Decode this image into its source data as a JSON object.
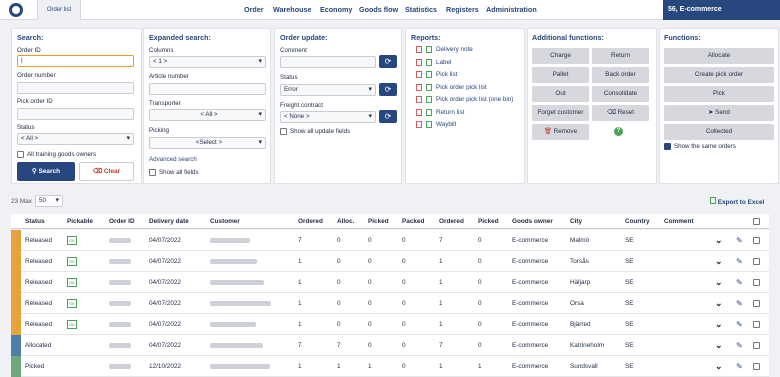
{
  "topbar": {
    "tab": "Order list",
    "nav": [
      "Order",
      "Warehouse",
      "Economy",
      "Goods flow",
      "Statistics",
      "Registers",
      "Administration"
    ],
    "user": "56, E-commerce"
  },
  "search": {
    "title": "Search:",
    "order_id_label": "Order ID",
    "order_number_label": "Order number",
    "pick_order_id_label": "Pick order ID",
    "status_label": "Status",
    "status_value": "< All >",
    "all_training": "All training goods owners",
    "search_btn": "Search",
    "clear_btn": "Clear"
  },
  "expanded": {
    "title": "Expanded search:",
    "columns_label": "Columns",
    "columns_value": "< 1 >",
    "article_label": "Article number",
    "transporter_label": "Transporter",
    "transporter_value": "< All >",
    "picking_label": "Picking",
    "picking_value": "<Select >",
    "advanced": "Advanced search",
    "show_all": "Show all fields"
  },
  "update": {
    "title": "Order update:",
    "comment_label": "Comment",
    "status_label": "Status",
    "status_value": "Error",
    "freight_label": "Freight contract",
    "freight_value": "< None >",
    "show_all": "Show all update fields"
  },
  "reports": {
    "title": "Reports:",
    "items": [
      "Delivery note",
      "Label",
      "Pick list",
      "Pick order pick list",
      "Pick order pick list (one bin)",
      "Return list",
      "Waybill"
    ]
  },
  "additional": {
    "title": "Additional functions:",
    "buttons": [
      "Charge",
      "Return",
      "Pallet",
      "Back order",
      "Out",
      "Consolidate",
      "Forget customer",
      "Reset",
      "Remove"
    ]
  },
  "functions": {
    "title": "Functions:",
    "buttons": [
      "Allocate",
      "Create pick order",
      "Pick",
      "Send",
      "Collected"
    ],
    "show_same": "Show the same orders"
  },
  "listbar": {
    "count": "23",
    "max_label": "Max",
    "max_value": "50",
    "export": "Export to Excel"
  },
  "table": {
    "headers": [
      "Status",
      "Pickable",
      "Order ID",
      "Delivery date",
      "Customer",
      "Ordered",
      "Alloc.",
      "Picked",
      "Packed",
      "Ordered",
      "Picked",
      "Goods owner",
      "City",
      "Country",
      "Comment"
    ],
    "rows": [
      {
        "status": "Released",
        "pickable": "OK",
        "date": "04/07/2022",
        "ordered": "7",
        "alloc": "0",
        "picked": "0",
        "packed": "0",
        "ordered2": "7",
        "picked2": "0",
        "owner": "E-commerce",
        "city": "Malmö",
        "country": "SE",
        "color": "#e8a23a"
      },
      {
        "status": "Released",
        "pickable": "OK",
        "date": "04/07/2022",
        "ordered": "1",
        "alloc": "0",
        "picked": "0",
        "packed": "0",
        "ordered2": "1",
        "picked2": "0",
        "owner": "E-commerce",
        "city": "Torsås",
        "country": "SE",
        "color": "#e8a23a"
      },
      {
        "status": "Released",
        "pickable": "OK",
        "date": "04/07/2022",
        "ordered": "1",
        "alloc": "0",
        "picked": "0",
        "packed": "0",
        "ordered2": "1",
        "picked2": "0",
        "owner": "E-commerce",
        "city": "Häljarp",
        "country": "SE",
        "color": "#e8a23a"
      },
      {
        "status": "Released",
        "pickable": "OK",
        "date": "04/07/2022",
        "ordered": "1",
        "alloc": "0",
        "picked": "0",
        "packed": "0",
        "ordered2": "1",
        "picked2": "0",
        "owner": "E-commerce",
        "city": "Orsa",
        "country": "SE",
        "color": "#e8a23a"
      },
      {
        "status": "Released",
        "pickable": "OK",
        "date": "04/07/2022",
        "ordered": "1",
        "alloc": "0",
        "picked": "0",
        "packed": "0",
        "ordered2": "1",
        "picked2": "0",
        "owner": "E-commerce",
        "city": "Bjärred",
        "country": "SE",
        "color": "#e8a23a"
      },
      {
        "status": "Allocated",
        "pickable": "",
        "date": "04/07/2022",
        "ordered": "7",
        "alloc": "7",
        "picked": "0",
        "packed": "0",
        "ordered2": "7",
        "picked2": "0",
        "owner": "E-commerce",
        "city": "Katrineholm",
        "country": "SE",
        "color": "#4f7fa8"
      },
      {
        "status": "Picked",
        "pickable": "",
        "date": "12/10/2022",
        "ordered": "1",
        "alloc": "1",
        "picked": "1",
        "packed": "0",
        "ordered2": "1",
        "picked2": "1",
        "owner": "E-commerce",
        "city": "Sundsvall",
        "country": "SE",
        "color": "#6ea87a"
      }
    ]
  }
}
